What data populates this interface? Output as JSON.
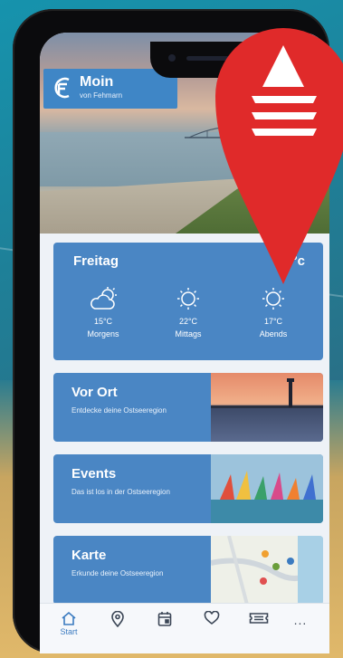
{
  "header": {
    "title": "Moin",
    "subtitle": "von Fehmarn"
  },
  "weather": {
    "day": "Freitag",
    "current_temp": "21°c",
    "periods": [
      {
        "temp": "15°C",
        "label": "Morgens",
        "icon": "cloud-sun-icon"
      },
      {
        "temp": "22°C",
        "label": "Mittags",
        "icon": "sun-icon"
      },
      {
        "temp": "17°C",
        "label": "Abends",
        "icon": "sun-icon"
      }
    ]
  },
  "cards": [
    {
      "title": "Vor Ort",
      "subtitle": "Entdecke deine Ostseeregion"
    },
    {
      "title": "Events",
      "subtitle": "Das ist los in der Ostseeregion"
    },
    {
      "title": "Karte",
      "subtitle": "Erkunde deine Ostseeregion"
    }
  ],
  "tabbar": {
    "items": [
      {
        "icon": "home-icon",
        "label": "Start",
        "active": true
      },
      {
        "icon": "location-pin-icon",
        "label": ""
      },
      {
        "icon": "calendar-icon",
        "label": ""
      },
      {
        "icon": "heart-icon",
        "label": ""
      },
      {
        "icon": "ticket-icon",
        "label": ""
      },
      {
        "icon": "more-icon",
        "label": ""
      }
    ],
    "more_text": "..."
  },
  "colors": {
    "card_blue": "#4a86c4",
    "pin_red": "#e02a2a",
    "tab_active": "#3b7bc0"
  }
}
